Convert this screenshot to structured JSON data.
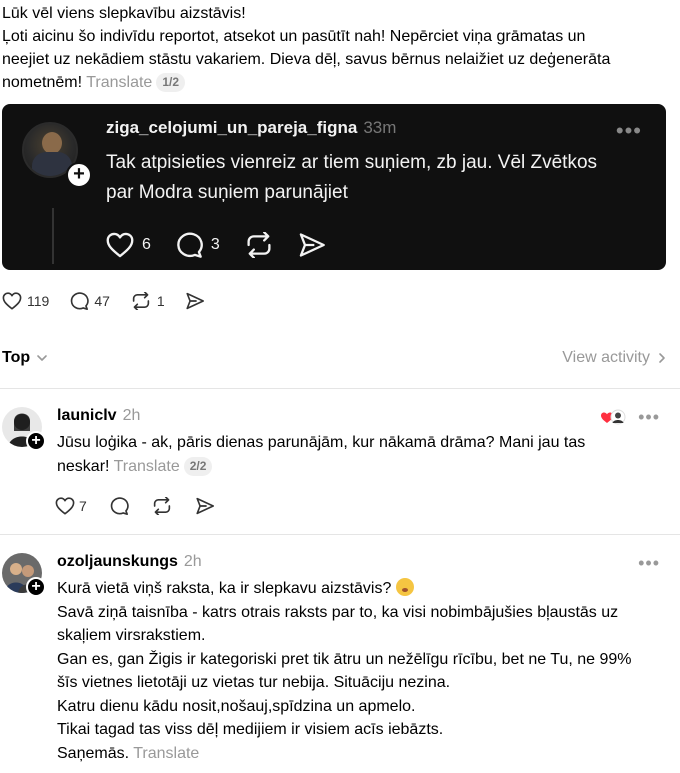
{
  "post": {
    "lines": [
      "Lūk vēl viens slepkavību aizstāvis!",
      "Ļoti aicinu šo indivīdu reportot, atsekot un pasūtīt nah! Nepērciet viņa grāmatas un",
      "neejiet uz nekādiem stāstu vakariem. Dieva dēļ, savus bērnus nelaižiet uz deģenerāta",
      "nometnēm!"
    ],
    "translate": "Translate",
    "page": "1/2"
  },
  "quote": {
    "username": "ziga_celojumi_un_pareja_figna",
    "time": "33m",
    "more": "•••",
    "text_line1": "Tak atpisieties vienreiz ar tiem suņiem, zb jau. Vēl Zvētkos",
    "text_line2": "par Modra suņiem parunājiet",
    "likes": "6",
    "replies": "3"
  },
  "post_stats": {
    "likes": "119",
    "replies": "47",
    "reposts": "1"
  },
  "filter": {
    "sort_label": "Top",
    "view_activity": "View activity"
  },
  "replies": [
    {
      "username": "launiclv",
      "time": "2h",
      "more": "•••",
      "line1": "Jūsu loģika - ak, pāris dienas parunājām, kur nākamā drāma? Mani jau tas",
      "line2": "neskar!",
      "translate": "Translate",
      "page": "2/2",
      "likes": "7"
    },
    {
      "username": "ozoljaunskungs",
      "time": "2h",
      "more": "•••",
      "lines": [
        "Kurā vietā viņš raksta, ka ir slepkavu aizstāvis?",
        "Savā ziņā taisnība - katrs otrais raksts par to, ka visi nobimbājušies bļaustās uz",
        "skaļiem virsrakstiem.",
        "Gan es, gan Žigis ir kategoriski pret tik ātru un nežēlīgu rīcību, bet ne Tu, ne 99%",
        "šīs vietnes lietotāji uz vietas tur nebija. Situāciju nezina.",
        "Katru dienu kādu nosit,nošauj,spīdzina un apmelo.",
        "Tikai tagad tas viss dēļ medijiem ir visiem acīs iebāzts.",
        "Saņemās."
      ],
      "translate": "Translate"
    }
  ],
  "icons": {
    "heart": "heart-icon",
    "comment": "comment-icon",
    "repost": "repost-icon",
    "share": "share-icon",
    "chevron_down": "chevron-down-icon",
    "chevron_right": "chevron-right-icon"
  },
  "colors": {
    "card_bg": "#101010",
    "like_red": "#ff3040",
    "muted": "#999999"
  }
}
